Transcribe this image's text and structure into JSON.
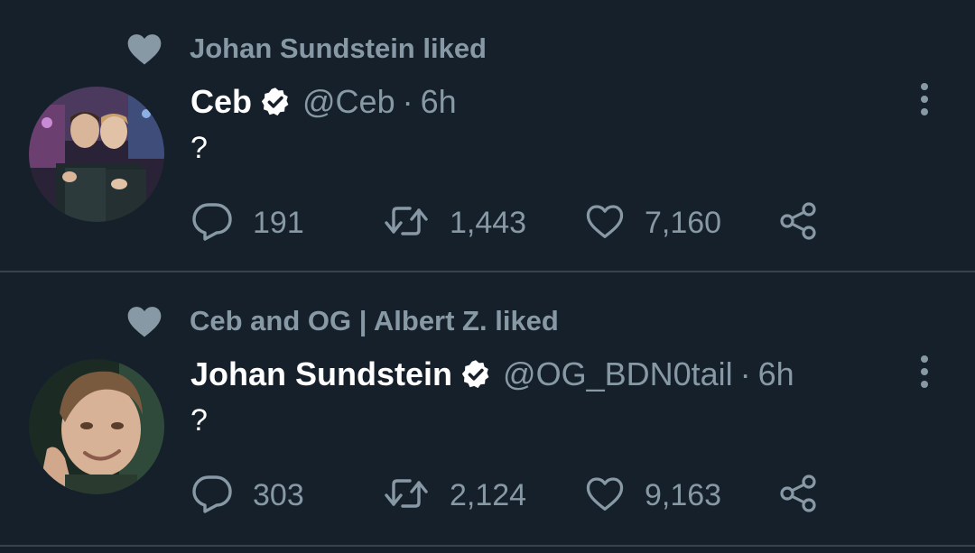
{
  "tweets": [
    {
      "social_context": "Johan Sundstein liked",
      "name": "Ceb",
      "handle": "@Ceb",
      "separator": "·",
      "time": "6h",
      "text": "?",
      "replies": "191",
      "retweets": "1,443",
      "likes": "7,160"
    },
    {
      "social_context": "Ceb and OG | Albert Z. liked",
      "name": "Johan Sundstein",
      "handle": "@OG_BDN0tail",
      "separator": "·",
      "time": "6h",
      "text": "?",
      "replies": "303",
      "retweets": "2,124",
      "likes": "9,163"
    }
  ],
  "icons": [
    "heart-icon",
    "verified-badge-icon",
    "more-vertical-icon",
    "reply-icon",
    "retweet-icon",
    "like-icon",
    "share-icon"
  ],
  "colors": {
    "background": "#15202b",
    "muted": "#8899a6",
    "divider": "#38444d",
    "text": "#ffffff"
  }
}
